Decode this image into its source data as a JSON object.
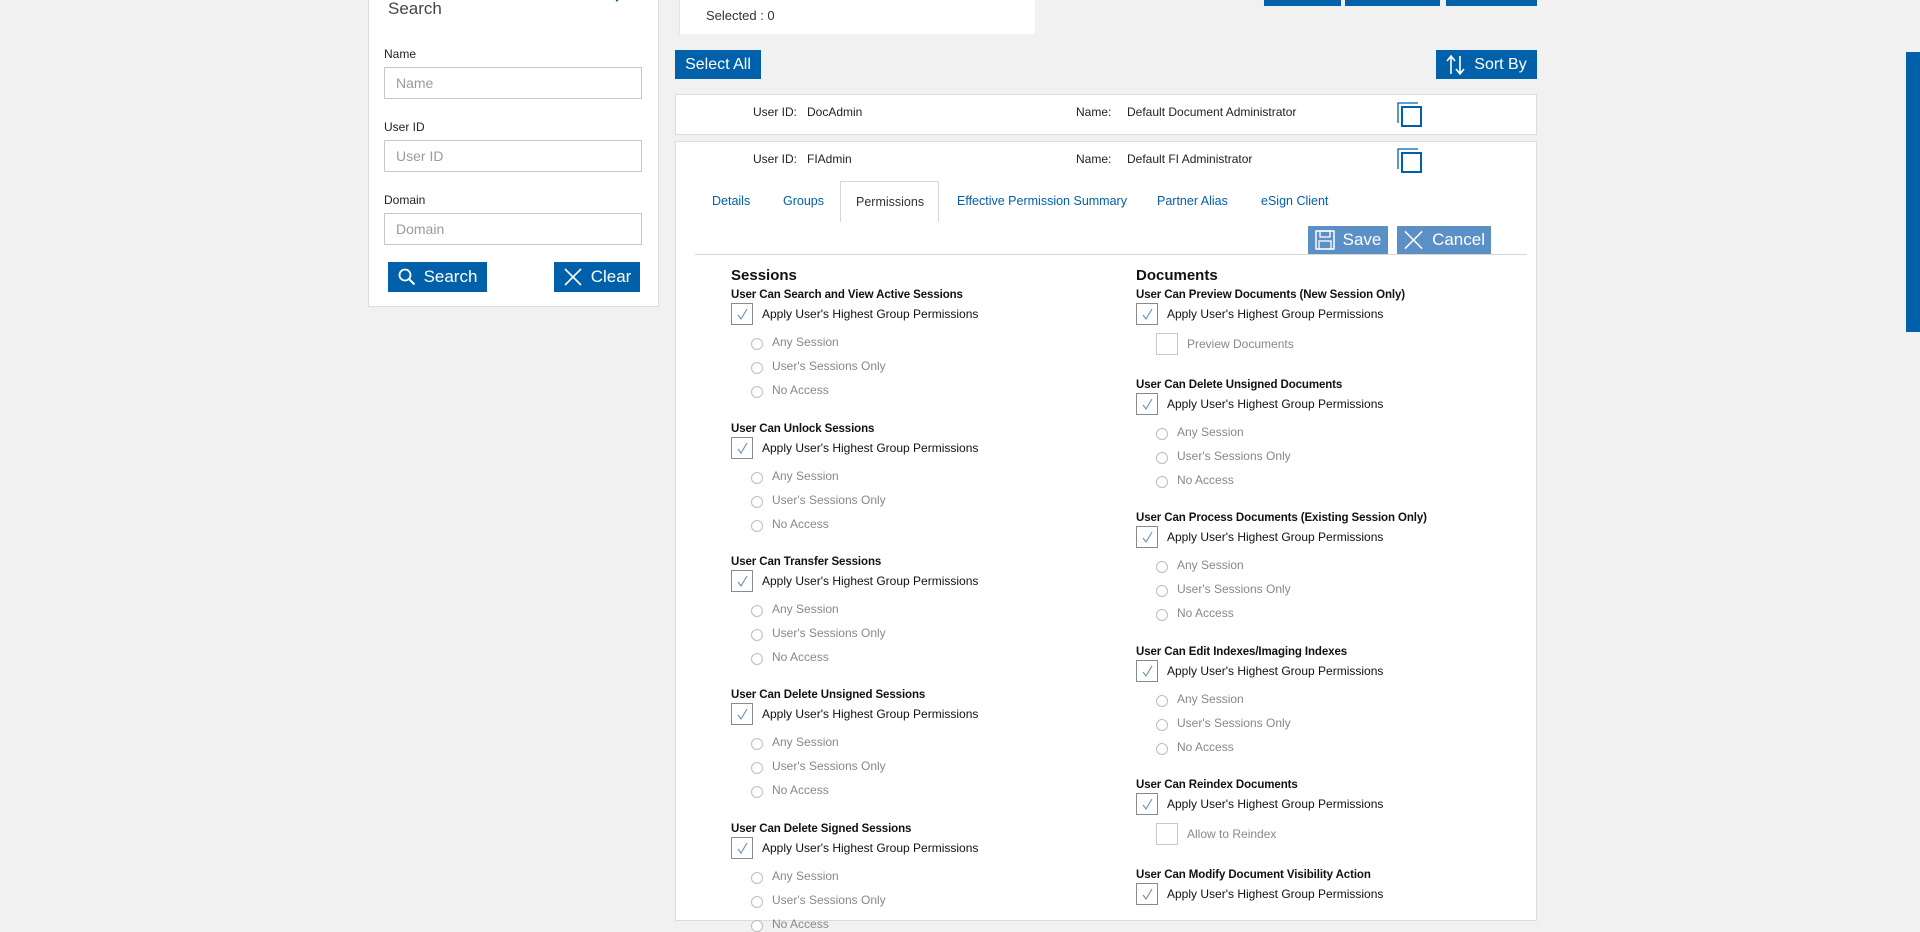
{
  "search": {
    "title": "Search",
    "name_label": "Name",
    "name_placeholder": "Name",
    "userid_label": "User ID",
    "userid_placeholder": "User ID",
    "domain_label": "Domain",
    "domain_placeholder": "Domain",
    "search_btn": "Search",
    "clear_btn": "Clear"
  },
  "selected": "Selected : 0",
  "select_all": "Select All",
  "sort_by": "Sort By",
  "users": [
    {
      "uid_label": "User ID:",
      "uid": "DocAdmin",
      "name_label": "Name:",
      "name": "Default Document Administrator"
    },
    {
      "uid_label": "User ID:",
      "uid": "FIAdmin",
      "name_label": "Name:",
      "name": "Default FI Administrator"
    }
  ],
  "tabs": [
    "Details",
    "Groups",
    "Permissions",
    "Effective Permission Summary",
    "Partner Alias",
    "eSign Client"
  ],
  "save_btn": "Save",
  "cancel_btn": "Cancel",
  "apply_label": "Apply User's Highest Group Permissions",
  "radio_opts": [
    "Any Session",
    "User's Sessions Only",
    "No Access"
  ],
  "sessions": {
    "title": "Sessions",
    "items": [
      "User Can Search and View Active Sessions",
      "User Can Unlock Sessions",
      "User Can Transfer Sessions",
      "User Can Delete Unsigned Sessions",
      "User Can Delete Signed Sessions"
    ]
  },
  "documents": {
    "title": "Documents",
    "items": [
      "User Can Preview Documents (New Session Only)",
      "User Can Delete Unsigned Documents",
      "User Can Process Documents (Existing Session Only)",
      "User Can Edit Indexes/Imaging Indexes",
      "User Can Reindex Documents",
      "User Can Modify Document Visibility Action"
    ],
    "preview_option": "Preview Documents",
    "reindex_option": "Allow to Reindex"
  },
  "colors": {
    "primary": "#0060a9",
    "light_primary": "#5a90c5"
  }
}
